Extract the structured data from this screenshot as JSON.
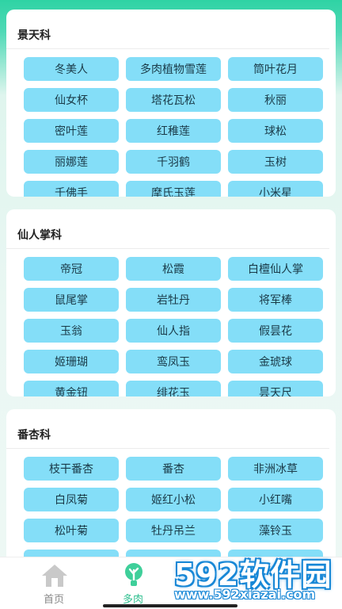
{
  "colors": {
    "accent": "#2fd3a4",
    "chip": "#84def8",
    "chip_text": "#1a3a48",
    "tab_active": "#2fbf8f",
    "tab_inactive": "#888888"
  },
  "sections": [
    {
      "title": "景天科",
      "items": [
        "冬美人",
        "多肉植物雪莲",
        "筒叶花月",
        "仙女杯",
        "塔花瓦松",
        "秋丽",
        "密叶莲",
        "红稚莲",
        "球松",
        "丽娜莲",
        "千羽鹤",
        "玉树",
        "千佛手",
        "摩氏玉莲",
        "小米星"
      ]
    },
    {
      "title": "仙人掌科",
      "items": [
        "帝冠",
        "松霞",
        "白檀仙人掌",
        "鼠尾掌",
        "岩牡丹",
        "将军棒",
        "玉翁",
        "仙人指",
        "假昙花",
        "姬珊瑚",
        "鸾凤玉",
        "金琥球",
        "黄金钮",
        "绯花玉",
        "昙天尺"
      ]
    },
    {
      "title": "番杏科",
      "items": [
        "枝干番杏",
        "番杏",
        "非洲冰草",
        "白凤菊",
        "姬红小松",
        "小红嘴",
        "松叶菊",
        "牡丹吊兰",
        "藻铃玉",
        "",
        "",
        ""
      ]
    }
  ],
  "tabbar": {
    "tabs": [
      {
        "label": "首页",
        "icon": "home-icon",
        "active": false
      },
      {
        "label": "多肉",
        "icon": "plant-icon",
        "active": true
      }
    ]
  },
  "watermark": {
    "brand": "592软件园",
    "url": "www.592xiazai.com"
  }
}
